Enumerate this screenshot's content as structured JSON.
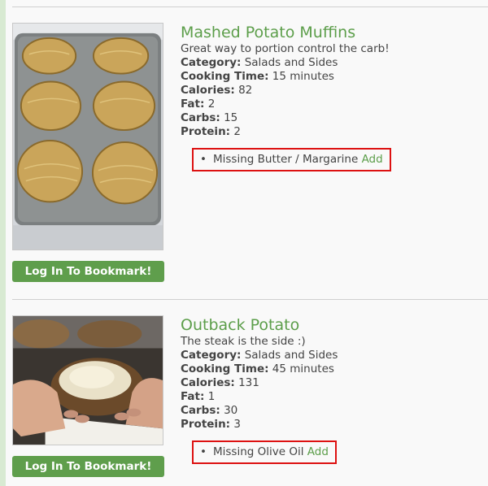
{
  "recipes": [
    {
      "title": "Mashed Potato Muffins",
      "description": "Great way to portion control the carb!",
      "category_label": "Category:",
      "category": "Salads and Sides",
      "cooking_time_label": "Cooking Time:",
      "cooking_time": "15 minutes",
      "calories_label": "Calories:",
      "calories": "82",
      "fat_label": "Fat:",
      "fat": "2",
      "carbs_label": "Carbs:",
      "carbs": "15",
      "protein_label": "Protein:",
      "protein": "2",
      "missing_text": "Missing Butter / Margarine",
      "add_label": "Add",
      "bookmark_label": "Log In To Bookmark!"
    },
    {
      "title": "Outback Potato",
      "description": "The steak is the side :)",
      "category_label": "Category:",
      "category": "Salads and Sides",
      "cooking_time_label": "Cooking Time:",
      "cooking_time": "45 minutes",
      "calories_label": "Calories:",
      "calories": "131",
      "fat_label": "Fat:",
      "fat": "1",
      "carbs_label": "Carbs:",
      "carbs": "30",
      "protein_label": "Protein:",
      "protein": "3",
      "missing_text": "Missing Olive Oil",
      "add_label": "Add",
      "bookmark_label": "Log In To Bookmark!"
    }
  ],
  "colors": {
    "accent_green": "#5c9e4a",
    "button_green": "#5f9e4c",
    "highlight_red": "#dd1111",
    "sidebar_green": "#d8ead2"
  }
}
